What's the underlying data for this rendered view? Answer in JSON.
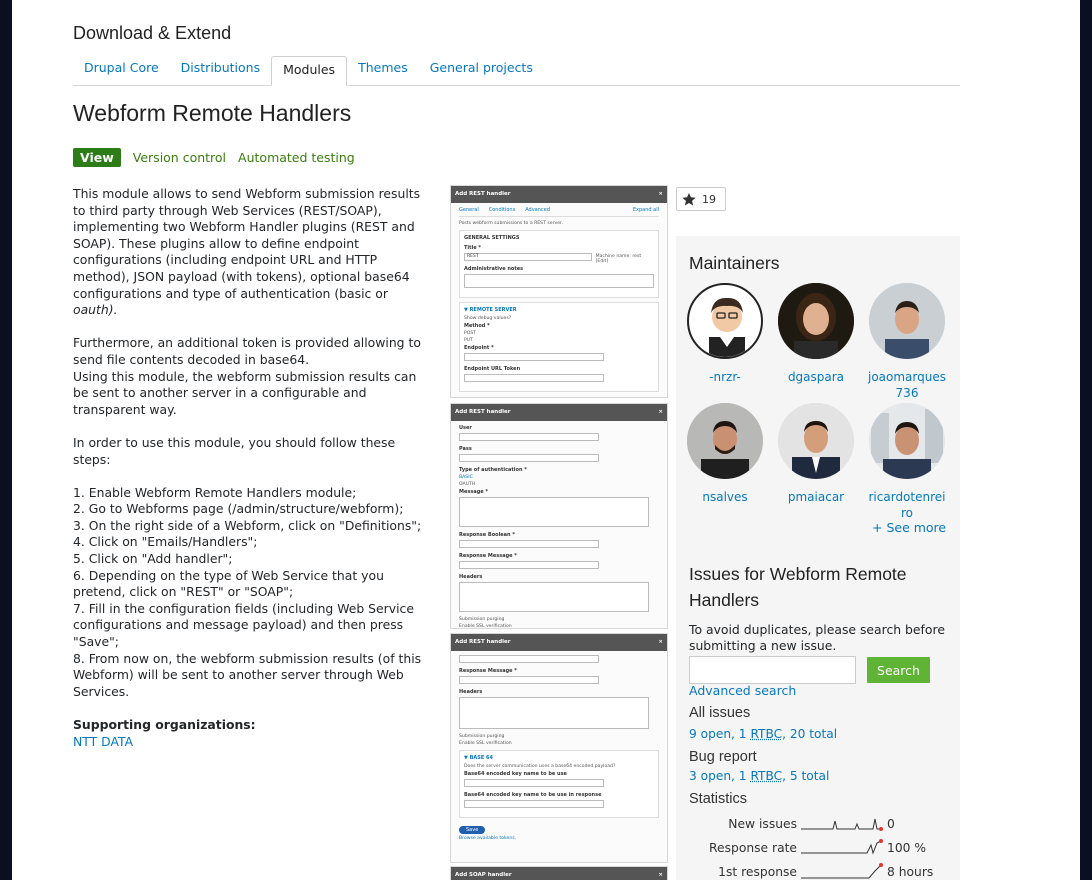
{
  "header": {
    "section_title": "Download & Extend"
  },
  "nav_tabs": [
    {
      "label": "Drupal Core",
      "active": false
    },
    {
      "label": "Distributions",
      "active": false
    },
    {
      "label": "Modules",
      "active": true
    },
    {
      "label": "Themes",
      "active": false
    },
    {
      "label": "General projects",
      "active": false
    }
  ],
  "project": {
    "title": "Webform Remote Handlers",
    "subtabs": [
      "View",
      "Version control",
      "Automated testing"
    ],
    "description": [
      "This module allows to send Webform submission results",
      "to third party through Web Services (REST/SOAP),",
      "implementing two Webform Handler plugins (REST and",
      "SOAP). These plugins allow to define endpoint",
      "configurations (including endpoint URL and HTTP",
      "method), JSON payload (with tokens), optional base64",
      "configurations and type of authentication (basic or",
      "oauth)."
    ],
    "para2": [
      "Furthermore, an additional token is provided allowing to",
      "send file contents decoded in base64.",
      "Using this module, the webform submission results can",
      "be sent to another server in a configurable and",
      "transparent way."
    ],
    "para3": [
      "In order to use this module, you should follow these",
      "steps:"
    ],
    "steps": [
      "1. Enable Webform Remote Handlers module;",
      "2. Go to Webforms page (/admin/structure/webform);",
      "3. On the right side of a Webform, click on \"Definitions\";",
      "4. Click on \"Emails/Handlers\";",
      "5. Click on \"Add handler\";",
      "6. Depending on the type of Web Service that you",
      "pretend, click on \"REST\" or \"SOAP\";",
      "7. Fill in the configuration fields (including Web Service",
      "configurations and message payload) and then press",
      "\"Save\";",
      "8. From now on, the webform submission results (of this",
      "Webform) will be sent to another server through Web",
      "Services."
    ],
    "supporting_title": "Supporting organizations:",
    "supporting_org": "NTT DATA",
    "star_count": "19"
  },
  "screenshots": {
    "shot1": {
      "title": "Add REST handler",
      "close": "×",
      "tabs": [
        "General",
        "Conditions",
        "Advanced"
      ],
      "expand": "Expand all",
      "intro": "Posts webform submissions to a REST server.",
      "general": "GENERAL SETTINGS",
      "title_label": "Title *",
      "title_value": "REST",
      "machine": "Machine name: rest [Edit]",
      "admin_notes": "Administrative notes",
      "remote": "▼ REMOTE SERVER",
      "debug": "Show debug values?",
      "method": "Method *",
      "post": "POST",
      "put": "PUT",
      "endpoint": "Endpoint *",
      "endpoint_token": "Endpoint URL Token"
    },
    "shot2": {
      "title": "Add REST handler",
      "close": "×",
      "user": "User",
      "pass": "Pass",
      "auth": "Type of authentication *",
      "basic": "BASIC",
      "oauth": "OAUTH",
      "message": "Message *",
      "resp_bool": "Response Boolean *",
      "resp_msg": "Response Message *",
      "headers": "Headers",
      "purging": "Submission purging",
      "ssl": "Enable SSL verification"
    },
    "shot3": {
      "title": "Add REST handler",
      "close": "×",
      "resp_msg": "Response Message *",
      "headers": "Headers",
      "purging": "Submission purging",
      "ssl": "Enable SSL verification",
      "base64": "▼ BASE 64",
      "b64_q": "Does the server communication uses a base64 encoded payload?",
      "b64_key": "Base64 encoded key name to be use",
      "b64_resp": "Base64 encoded key name to be use in response",
      "save": "Save",
      "tokens": "Browse available tokens."
    },
    "shot4": {
      "title": "Add SOAP handler",
      "close": "×"
    }
  },
  "sidebar": {
    "maintainers_title": "Maintainers",
    "maintainers": [
      {
        "name": "-nrzr-"
      },
      {
        "name": "dgaspara"
      },
      {
        "name": "joaomarques\n736"
      },
      {
        "name": "nsalves"
      },
      {
        "name": "pmaiacar"
      },
      {
        "name": "ricardotenrei\nro"
      }
    ],
    "see_more": "+ See more",
    "issues_title_1": "Issues for Webform Remote",
    "issues_title_2": "Handlers",
    "issues_intro": "To avoid duplicates, please search before submitting a new issue.",
    "search_placeholder": "",
    "search_button": "Search",
    "advanced_search": "Advanced search",
    "all_issues": "All issues",
    "all_open": "9 open",
    "all_rtbc": "RTBC",
    "all_rtbc_count": "1",
    "all_total": "20 total",
    "bug_report": "Bug report",
    "bug_open": "3 open",
    "bug_rtbc": "RTBC",
    "bug_rtbc_count": "1",
    "bug_total": "5 total",
    "statistics": "Statistics",
    "stats": [
      {
        "label": "New issues",
        "value": "0"
      },
      {
        "label": "Response rate",
        "value": "100 %"
      },
      {
        "label": "1st response",
        "value": "8 hours"
      }
    ]
  },
  "colors": {
    "link": "#0678be",
    "green_tab": "#2c7d17",
    "search_button": "#5fb335",
    "sparkline_dot": "#e5352b"
  }
}
